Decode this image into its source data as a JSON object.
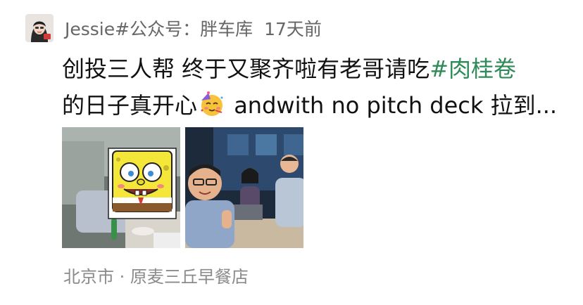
{
  "post": {
    "author": "Jessie#公众号：胖车库",
    "time": "17天前",
    "content_line1_pre": "创投三人帮 终于又聚齐啦有老哥请吃",
    "hashtag": "#肉桂卷",
    "content_line2_pre": "的日子真开心",
    "emoji": "partying-face-emoji",
    "content_line2_post": " andwith no pitch deck 拉到...",
    "photos": [
      {
        "name": "photo-spongebob-meeting",
        "icon": "spongebob-sticker"
      },
      {
        "name": "photo-group-selfie",
        "icon": "group-selfie"
      }
    ],
    "location": "北京市 · 原麦三丘早餐店"
  },
  "colors": {
    "hashtag": "#2e8b57",
    "meta": "#666666",
    "location": "#8a8a8a",
    "text": "#111111"
  }
}
